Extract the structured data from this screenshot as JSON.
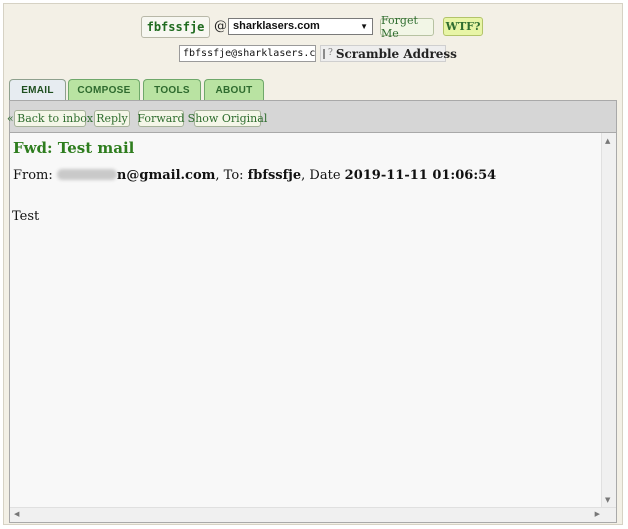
{
  "header": {
    "username": "fbfssfje",
    "at": "@",
    "domain": "sharklasers.com",
    "forget_label": "Forget Me",
    "wtf_label": "WTF?",
    "email_address": "fbfssfje@sharklasers.com",
    "scramble_label": "Scramble Address",
    "scramble_checked": false
  },
  "tabs": [
    {
      "label": "EMAIL",
      "active": true
    },
    {
      "label": "COMPOSE",
      "active": false
    },
    {
      "label": "TOOLS",
      "active": false
    },
    {
      "label": "ABOUT",
      "active": false
    }
  ],
  "toolbar": {
    "back_label": "« Back to inbox",
    "reply_label": "Reply",
    "forward_label": "Forward",
    "original_label": "Show Original"
  },
  "message": {
    "subject": "Fwd: Test mail",
    "from_label": "From:",
    "from_domain": "n@gmail.com",
    "to_label": ", To:",
    "to": "fbfssfje",
    "date_label": ", Date",
    "date": "2019-11-11 01:06:54",
    "body": "Test"
  },
  "icons": {
    "dropdown": "chevron-down-icon",
    "help": "help-icon",
    "scroll_up": "arrow-up-icon",
    "scroll_down": "arrow-down-icon",
    "scroll_left": "arrow-left-icon",
    "scroll_right": "arrow-right-icon"
  },
  "colors": {
    "accent_green": "#2e7d1e",
    "tab_green": "#b9e3a2",
    "toolbar_gray": "#d6d6d6"
  }
}
